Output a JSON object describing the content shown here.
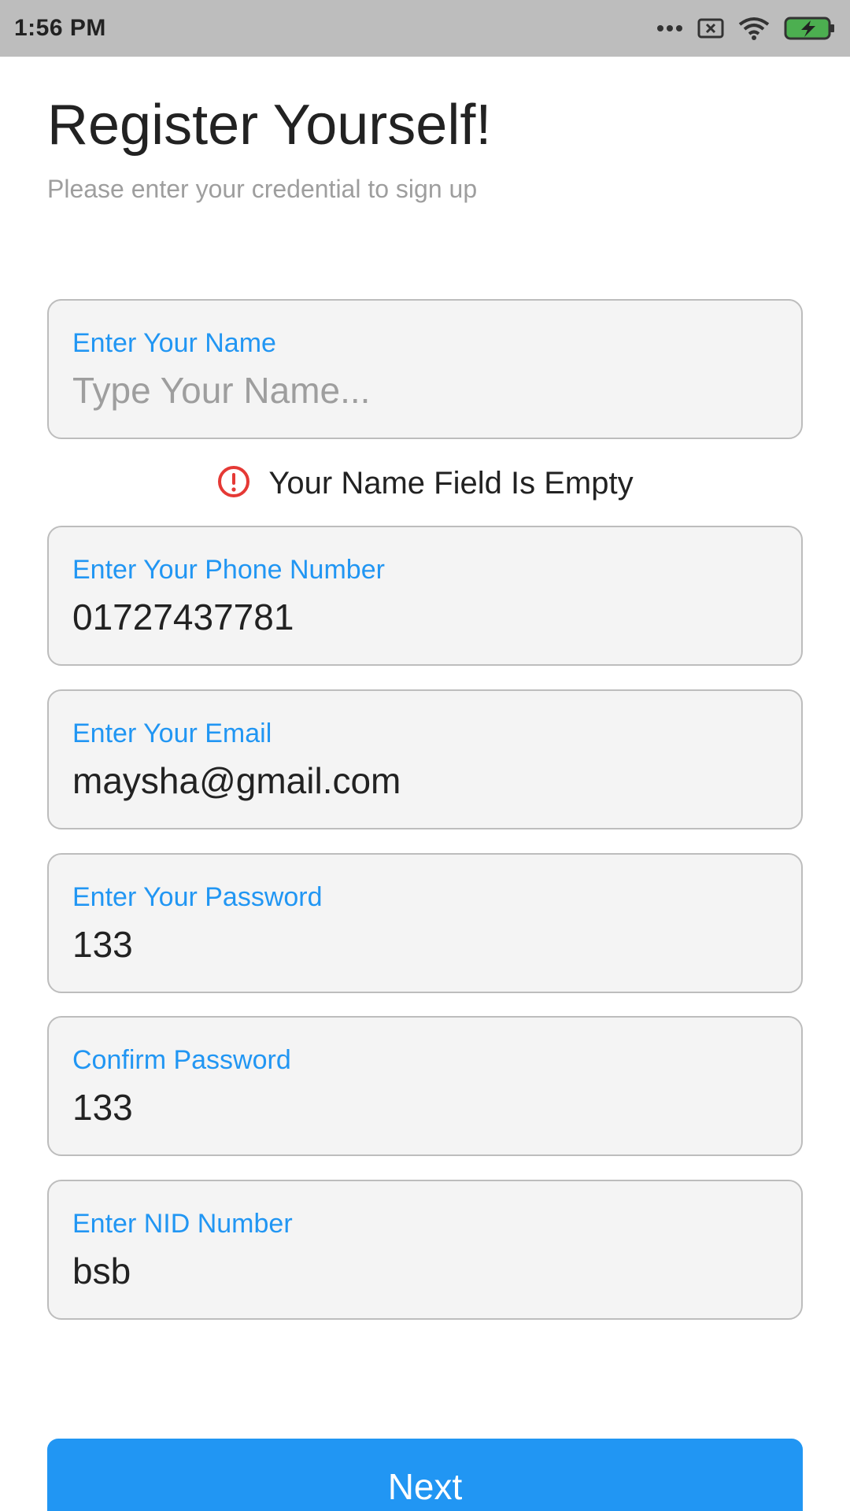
{
  "status_bar": {
    "time": "1:56 PM",
    "icons": [
      "more-dots-icon",
      "sim-off-icon",
      "wifi-icon",
      "battery-charging-icon"
    ],
    "battery_color": "#4caf50"
  },
  "page": {
    "title": "Register Yourself!",
    "subtitle": "Please enter your credential to sign up"
  },
  "fields": [
    {
      "label": "Enter Your Name",
      "value": "",
      "placeholder": "Type Your Name..."
    },
    {
      "label": "Enter Your Phone Number",
      "value": "01727437781",
      "placeholder": ""
    },
    {
      "label": "Enter Your Email",
      "value": "maysha@gmail.com",
      "placeholder": ""
    },
    {
      "label": "Enter Your Password",
      "value": "133",
      "placeholder": ""
    },
    {
      "label": "Confirm Password",
      "value": "133",
      "placeholder": ""
    },
    {
      "label": "Enter NID Number",
      "value": "bsb",
      "placeholder": ""
    }
  ],
  "error": {
    "icon": "error-icon",
    "message": "Your Name Field Is Empty",
    "color": "#e53935"
  },
  "actions": {
    "next_label": "Next"
  },
  "colors": {
    "accent": "#2196f3",
    "field_bg": "#f4f4f4",
    "status_bar_bg": "#bdbdbd"
  }
}
